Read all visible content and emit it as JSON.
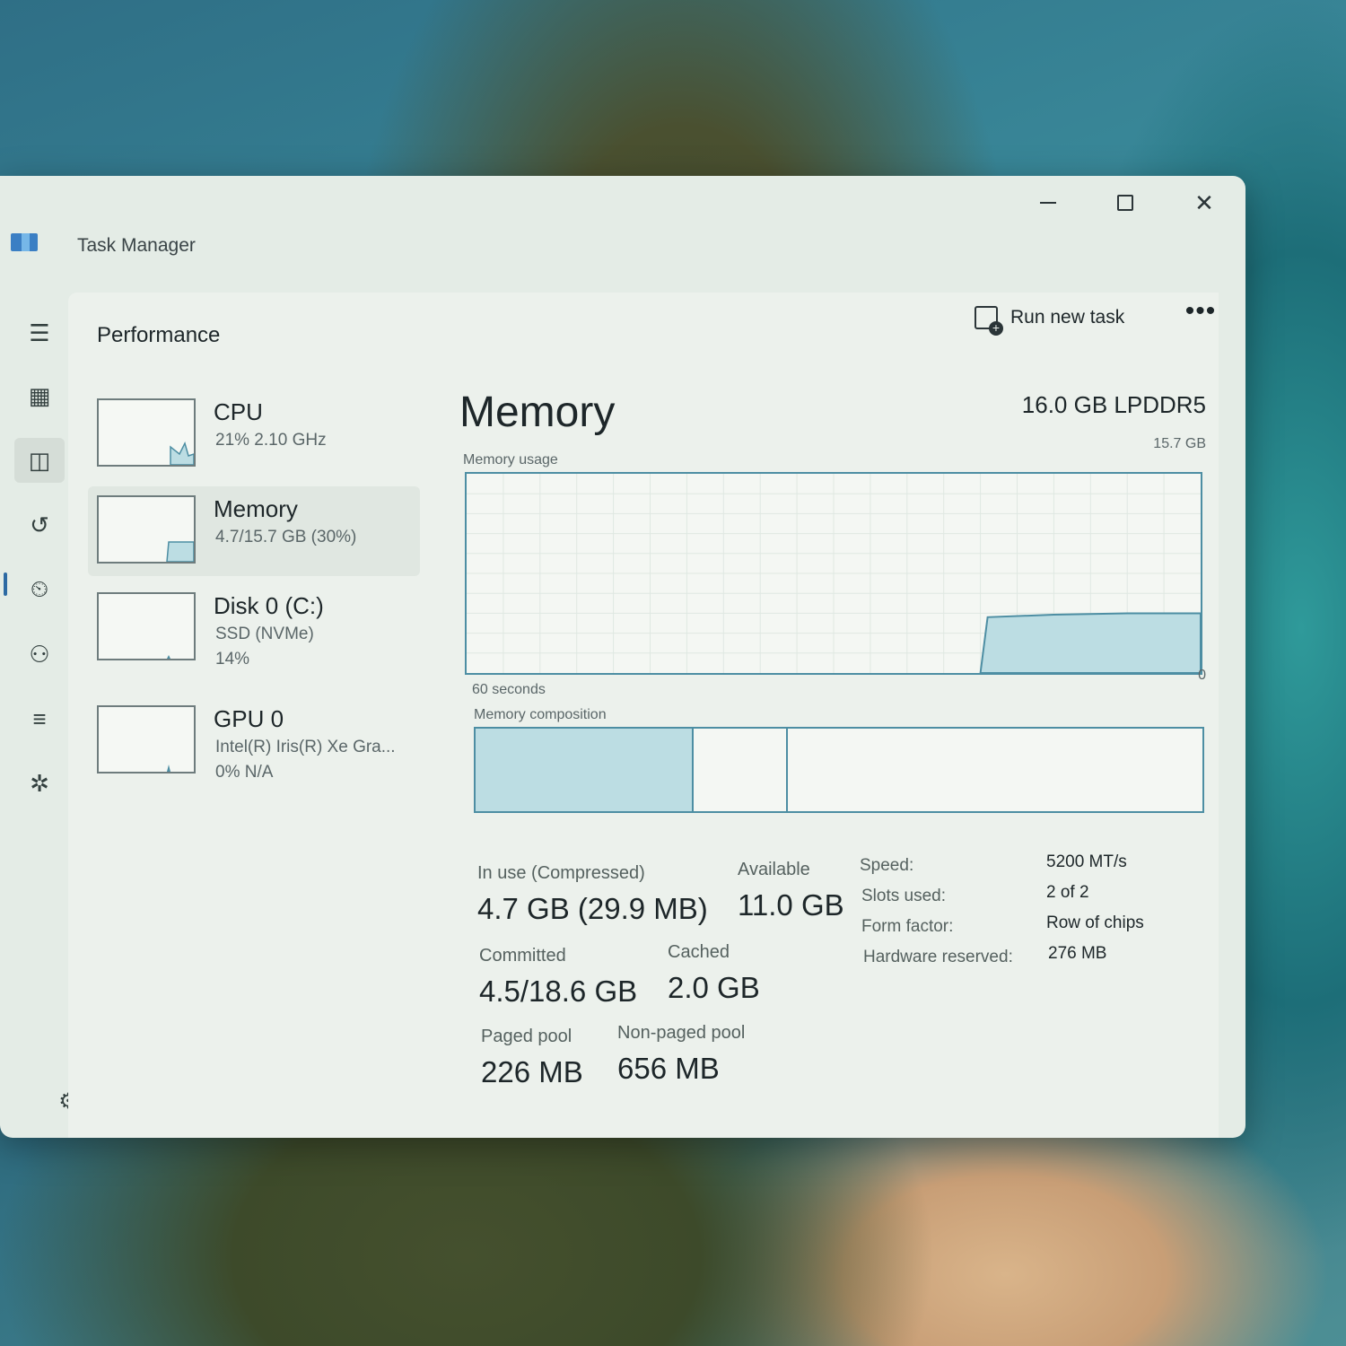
{
  "window": {
    "title": "Task Manager"
  },
  "nav": {
    "items": [
      {
        "name": "hamburger-menu-icon",
        "glyph": "☰"
      },
      {
        "name": "processes-icon",
        "glyph": "▦"
      },
      {
        "name": "performance-icon",
        "glyph": "◫",
        "active": true
      },
      {
        "name": "app-history-icon",
        "glyph": "↺"
      },
      {
        "name": "startup-apps-icon",
        "glyph": "⏲"
      },
      {
        "name": "users-icon",
        "glyph": "⚇"
      },
      {
        "name": "details-icon",
        "glyph": "≡"
      },
      {
        "name": "services-icon",
        "glyph": "✲"
      }
    ],
    "settings_glyph": "⚙"
  },
  "header": {
    "page_title": "Performance",
    "run_new_task": "Run new task",
    "more": "•••"
  },
  "devices": [
    {
      "name": "CPU",
      "sub1": "21%  2.10 GHz",
      "sub2": "",
      "fill": 0.21
    },
    {
      "name": "Memory",
      "sub1": "4.7/15.7 GB (30%)",
      "sub2": "",
      "fill": 0.3,
      "selected": true
    },
    {
      "name": "Disk 0 (C:)",
      "sub1": "SSD (NVMe)",
      "sub2": "14%",
      "fill": 0.02
    },
    {
      "name": "GPU 0",
      "sub1": "Intel(R) Iris(R) Xe Gra...",
      "sub2": "0%  N/A",
      "fill": 0.02
    }
  ],
  "memory": {
    "title": "Memory",
    "type": "16.0 GB LPDDR5",
    "usage_label": "Memory usage",
    "max_label": "15.7 GB",
    "time_label": "60 seconds",
    "zero_label": "0",
    "composition_label": "Memory composition",
    "composition": [
      0.3,
      0.13,
      0.57
    ],
    "usage_history": {
      "max": 15.7,
      "start_fraction": 0.7,
      "values": [
        4.4,
        4.6,
        4.7,
        4.7
      ]
    },
    "stats": {
      "in_use_label": "In use (Compressed)",
      "in_use_value": "4.7 GB (29.9 MB)",
      "available_label": "Available",
      "available_value": "11.0 GB",
      "committed_label": "Committed",
      "committed_value": "4.5/18.6 GB",
      "cached_label": "Cached",
      "cached_value": "2.0 GB",
      "paged_label": "Paged pool",
      "paged_value": "226 MB",
      "nonpaged_label": "Non-paged pool",
      "nonpaged_value": "656 MB"
    },
    "specs": {
      "speed_label": "Speed:",
      "speed_value": "5200 MT/s",
      "slots_label": "Slots used:",
      "slots_value": "2 of 2",
      "form_label": "Form factor:",
      "form_value": "Row of chips",
      "reserved_label": "Hardware reserved:",
      "reserved_value": "276 MB"
    }
  },
  "colors": {
    "accent": "#4d8ea3",
    "fill": "#bcdde3"
  }
}
